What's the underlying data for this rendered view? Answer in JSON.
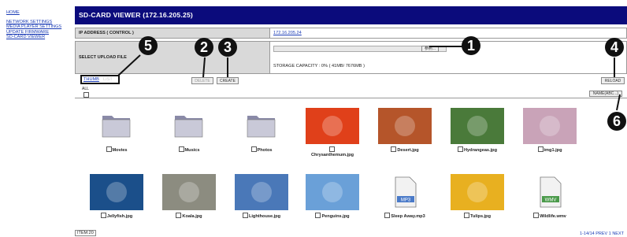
{
  "sidebar": {
    "home": "HOME",
    "links": [
      "NETWORK SETTINGS",
      "MEDIA PLAYER SETTINGS",
      "UPDATE FIRMWARE",
      "SD-CARD VIEWER"
    ]
  },
  "header": {
    "title": "SD-CARD VIEWER (172.16.205.25)"
  },
  "ip_row": {
    "label": "IP ADDRESS ( CONTROL )",
    "value": "172.16.205.24"
  },
  "upload_row": {
    "label": "SELECT UPLOAD FILE",
    "browse_label": "参照...",
    "storage": "STORAGE CAPACITY : 0% ( 41MB/ 7676MB )"
  },
  "toolbar": {
    "tab_thumb": "THUMB",
    "tab_list": "LIST",
    "delete": "DELETE",
    "create": "CREATE",
    "reload": "RELOAD",
    "all": "ALL",
    "sort": "NAME(ABC...)"
  },
  "callouts": [
    "1",
    "2",
    "3",
    "4",
    "5",
    "6"
  ],
  "files": [
    {
      "name": "Movies",
      "kind": "folder"
    },
    {
      "name": "Musics",
      "kind": "folder"
    },
    {
      "name": "Photos",
      "kind": "folder"
    },
    {
      "name": "Chrysanthemum.jpg",
      "kind": "image",
      "color": "#e0401a"
    },
    {
      "name": "Desert.jpg",
      "kind": "image",
      "color": "#b5552a"
    },
    {
      "name": "Hydrangeas.jpg",
      "kind": "image",
      "color": "#4a7a3a"
    },
    {
      "name": "img1.jpg",
      "kind": "image",
      "color": "#c9a3b8"
    },
    {
      "name": "Jellyfish.jpg",
      "kind": "image",
      "color": "#1b4f8a"
    },
    {
      "name": "Koala.jpg",
      "kind": "image",
      "color": "#8c8c80"
    },
    {
      "name": "Lighthouse.jpg",
      "kind": "image",
      "color": "#4a78b8"
    },
    {
      "name": "Penguins.jpg",
      "kind": "image",
      "color": "#6aa0d8"
    },
    {
      "name": "Sleep Away.mp3",
      "kind": "mp3"
    },
    {
      "name": "Tulips.jpg",
      "kind": "image",
      "color": "#e8b020"
    },
    {
      "name": "Wildlife.wmv",
      "kind": "wmv"
    }
  ],
  "footer": {
    "items": "ITEM:20",
    "pager": "1-14/14 PREV 1 NEXT"
  }
}
